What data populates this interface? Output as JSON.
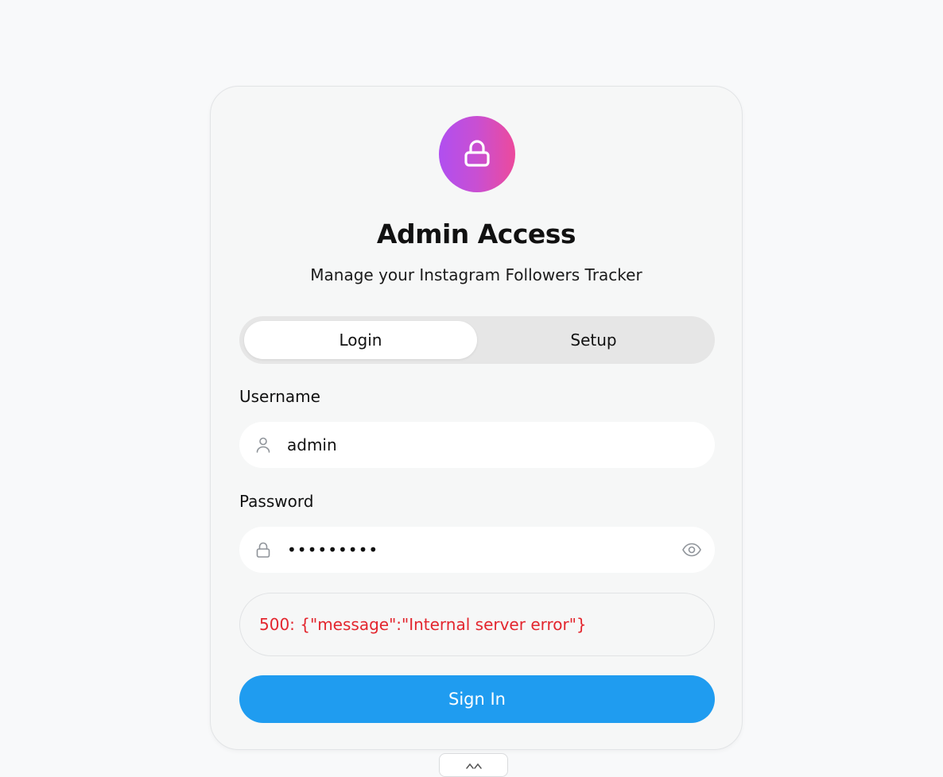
{
  "header": {
    "title": "Admin Access",
    "subtitle": "Manage your Instagram Followers Tracker",
    "icon": "lock-icon"
  },
  "tabs": [
    {
      "label": "Login",
      "active": true
    },
    {
      "label": "Setup",
      "active": false
    }
  ],
  "form": {
    "username_label": "Username",
    "username_value": "admin",
    "username_icon": "user-icon",
    "password_label": "Password",
    "password_value": "•••••••••",
    "password_icon": "lock-icon",
    "password_toggle_icon": "eye-icon"
  },
  "error": {
    "message": "500: {\"message\":\"Internal server error\"}"
  },
  "submit": {
    "label": "Sign In"
  },
  "colors": {
    "accent": "#1f9cf0",
    "error": "#e3262e",
    "gradient_start": "#b04ff0",
    "gradient_end": "#ec4a9c"
  },
  "bottom_handle_icon": "chevron-up-icon"
}
